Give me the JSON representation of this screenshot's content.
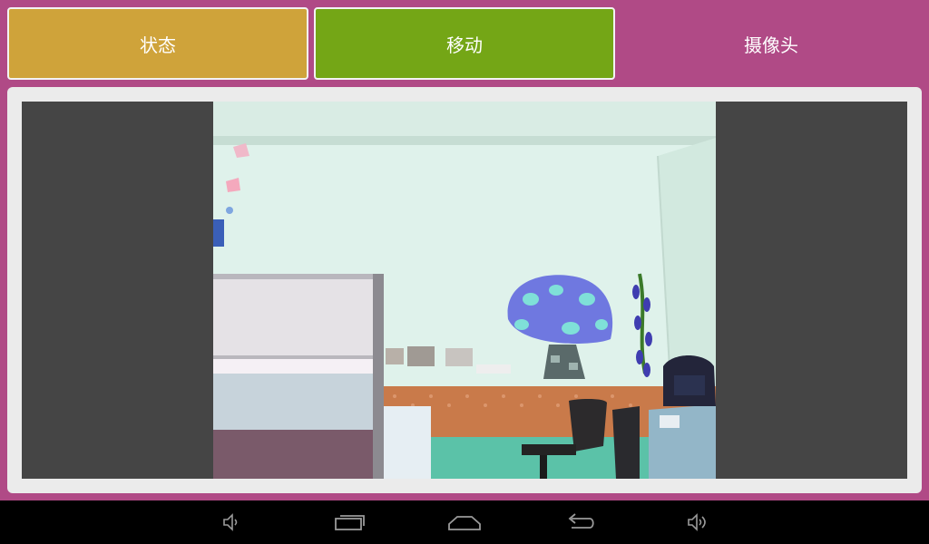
{
  "tabs": [
    {
      "label": "状态",
      "color": "#cfa33a"
    },
    {
      "label": "移动",
      "color": "#74a616"
    },
    {
      "label": "摄像头",
      "color": "#b04a86",
      "selected": true
    }
  ],
  "camera": {
    "feed_icons": [
      "mushroom-decoration",
      "office-chair",
      "backpack",
      "cubicle-partition"
    ]
  },
  "navbar": {
    "buttons": [
      "volume-down-icon",
      "recent-apps-icon",
      "home-icon",
      "back-icon",
      "volume-up-icon"
    ]
  },
  "colors": {
    "background": "#b04a86",
    "panel": "#ebebeb",
    "viewer": "#454545",
    "navbar": "#000000"
  }
}
